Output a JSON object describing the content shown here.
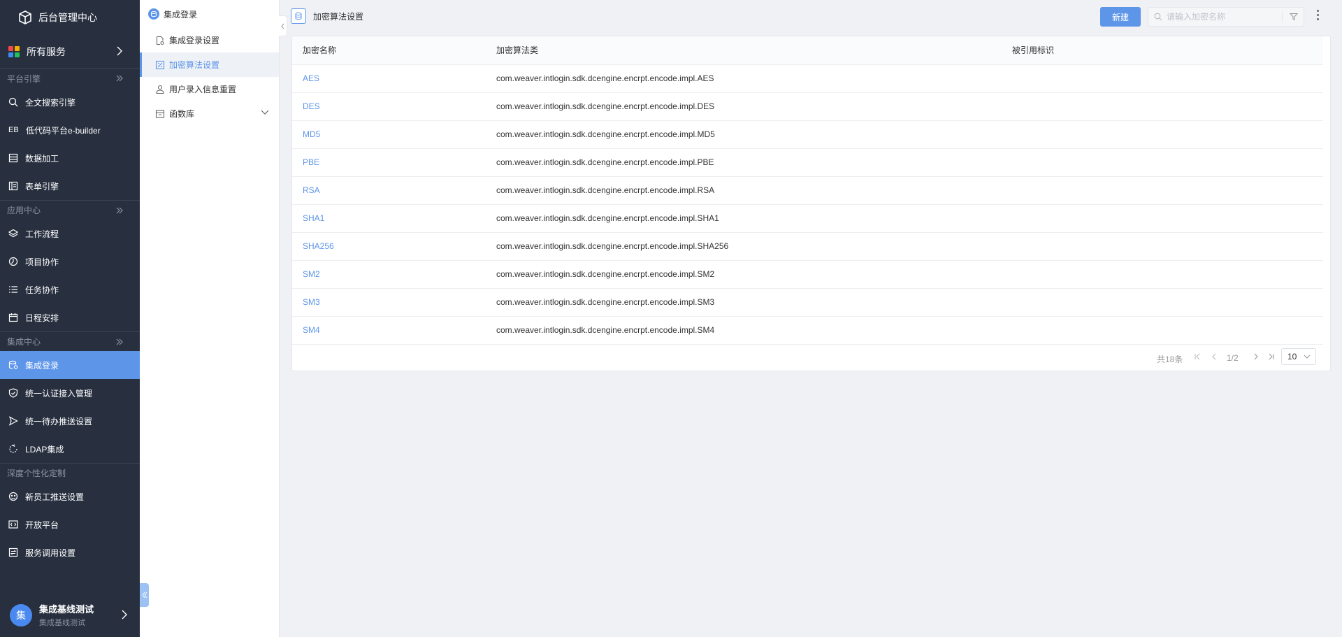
{
  "app": {
    "title": "后台管理中心"
  },
  "sidebar": {
    "all_services": "所有服务",
    "sections": [
      {
        "title": "平台引擎",
        "items": [
          {
            "label": "全文搜索引擎",
            "icon": "search-icon"
          },
          {
            "label": "低代码平台e-builder",
            "icon": "eb-icon",
            "icon_text": "EB"
          },
          {
            "label": "数据加工",
            "icon": "data-process-icon"
          },
          {
            "label": "表单引擎",
            "icon": "form-engine-icon"
          }
        ]
      },
      {
        "title": "应用中心",
        "items": [
          {
            "label": "工作流程",
            "icon": "workflow-icon"
          },
          {
            "label": "项目协作",
            "icon": "project-icon"
          },
          {
            "label": "任务协作",
            "icon": "task-icon"
          },
          {
            "label": "日程安排",
            "icon": "calendar-icon"
          }
        ]
      },
      {
        "title": "集成中心",
        "items": [
          {
            "label": "集成登录",
            "icon": "integration-login-icon",
            "active": true
          },
          {
            "label": "统一认证接入管理",
            "icon": "shield-icon"
          },
          {
            "label": "统一待办推送设置",
            "icon": "send-icon"
          },
          {
            "label": "LDAP集成",
            "icon": "ldap-icon"
          }
        ]
      },
      {
        "title": "深度个性化定制",
        "items": [
          {
            "label": "新员工推送设置",
            "icon": "new-staff-icon"
          },
          {
            "label": "开放平台",
            "icon": "code-icon"
          },
          {
            "label": "服务调用设置",
            "icon": "service-icon"
          }
        ]
      }
    ],
    "user": {
      "avatar_text": "集",
      "name": "集成基线测试",
      "sub": "集成基线测试"
    }
  },
  "subpanel": {
    "title": "集成登录",
    "items": [
      {
        "label": "集成登录设置"
      },
      {
        "label": "加密算法设置",
        "active": true
      },
      {
        "label": "用户录入信息重置"
      },
      {
        "label": "函数库"
      }
    ]
  },
  "main": {
    "title": "加密算法设置",
    "new_button": "新建",
    "search_placeholder": "请输入加密名称",
    "columns": [
      "加密名称",
      "加密算法类",
      "被引用标识"
    ],
    "rows": [
      {
        "name": "AES",
        "cls": "com.weaver.intlogin.sdk.dcengine.encrpt.encode.impl.AES",
        "ref": ""
      },
      {
        "name": "DES",
        "cls": "com.weaver.intlogin.sdk.dcengine.encrpt.encode.impl.DES",
        "ref": ""
      },
      {
        "name": "MD5",
        "cls": "com.weaver.intlogin.sdk.dcengine.encrpt.encode.impl.MD5",
        "ref": ""
      },
      {
        "name": "PBE",
        "cls": "com.weaver.intlogin.sdk.dcengine.encrpt.encode.impl.PBE",
        "ref": ""
      },
      {
        "name": "RSA",
        "cls": "com.weaver.intlogin.sdk.dcengine.encrpt.encode.impl.RSA",
        "ref": ""
      },
      {
        "name": "SHA1",
        "cls": "com.weaver.intlogin.sdk.dcengine.encrpt.encode.impl.SHA1",
        "ref": ""
      },
      {
        "name": "SHA256",
        "cls": "com.weaver.intlogin.sdk.dcengine.encrpt.encode.impl.SHA256",
        "ref": ""
      },
      {
        "name": "SM2",
        "cls": "com.weaver.intlogin.sdk.dcengine.encrpt.encode.impl.SM2",
        "ref": ""
      },
      {
        "name": "SM3",
        "cls": "com.weaver.intlogin.sdk.dcengine.encrpt.encode.impl.SM3",
        "ref": ""
      },
      {
        "name": "SM4",
        "cls": "com.weaver.intlogin.sdk.dcengine.encrpt.encode.impl.SM4",
        "ref": ""
      }
    ],
    "pagination": {
      "total": "共18条",
      "page": "1/2",
      "page_size": "10"
    }
  },
  "colors": {
    "sidebar_bg": "#283040",
    "accent": "#5d95e9",
    "page_bg": "#f0f1f5"
  }
}
